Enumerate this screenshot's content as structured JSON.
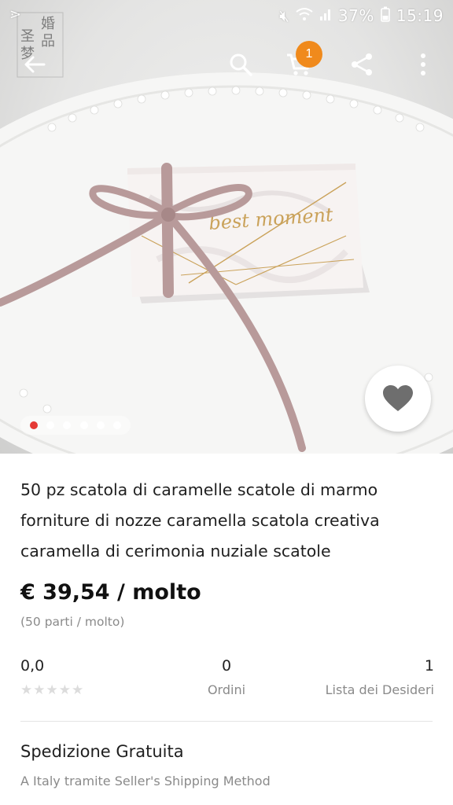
{
  "status_bar": {
    "battery": "37%",
    "time": "15:19"
  },
  "logo": {
    "text": "婚品·圣梦"
  },
  "toolbar": {
    "back_icon": "back-arrow-icon",
    "search_icon": "search-icon",
    "cart_icon": "cart-icon",
    "cart_count": "1",
    "share_icon": "share-icon",
    "more_icon": "more-vertical-icon"
  },
  "hero": {
    "box_text": "best moment",
    "pager": {
      "count": 6,
      "active_index": 0
    },
    "favorite_icon": "heart-icon"
  },
  "product": {
    "title_lines": [
      "50 pz scatola di caramelle scatole di marmo",
      "forniture di nozze caramella scatola creativa",
      "caramella di cerimonia nuziale scatole"
    ],
    "price": "€ 39,54 / molto",
    "unit_note": "(50 parti / molto)"
  },
  "stats": {
    "rating_value": "0,0",
    "rating_stars": 0,
    "orders_value": "0",
    "orders_label": "Ordini",
    "wishlist_value": "1",
    "wishlist_label": "Lista dei Desideri"
  },
  "shipping": {
    "title": "Spedizione Gratuita",
    "subtitle": "A Italy tramite Seller's Shipping Method"
  },
  "colors": {
    "accent_red": "#e53935",
    "badge_orange": "#f08a1c",
    "box_gold": "#caa25a",
    "ribbon_pink": "#b89a9a"
  }
}
